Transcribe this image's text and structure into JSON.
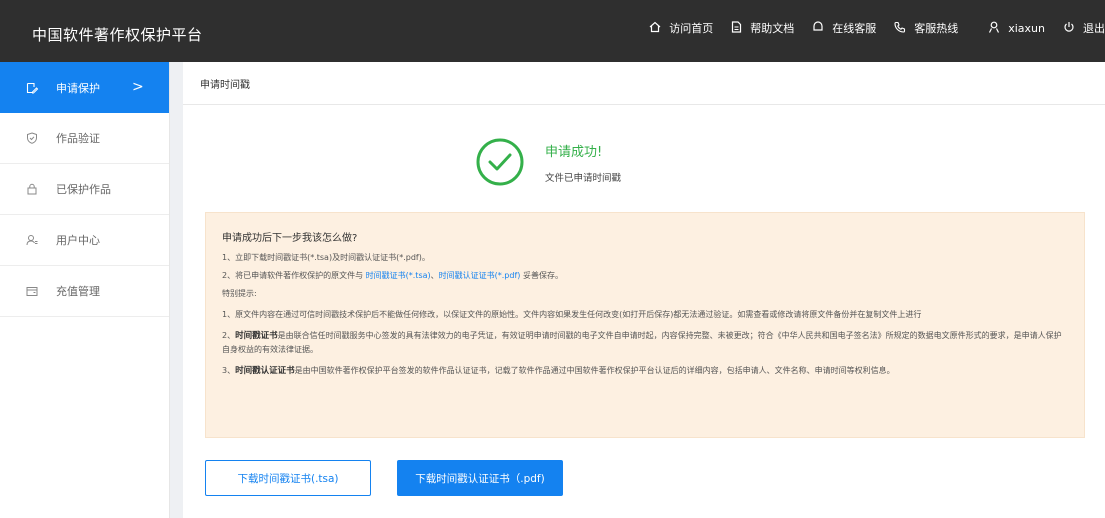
{
  "header": {
    "app_title": "中国软件著作权保护平台",
    "nav": [
      {
        "label": "访问首页",
        "icon": "home-icon"
      },
      {
        "label": "帮助文档",
        "icon": "document-icon"
      },
      {
        "label": "在线客服",
        "icon": "chat-icon"
      },
      {
        "label": "客服热线",
        "icon": "phone-icon"
      },
      {
        "label": "xiaxun",
        "icon": "user-icon"
      },
      {
        "label": "退出",
        "icon": "power-icon"
      }
    ]
  },
  "sidebar": {
    "items": [
      {
        "label": "申请保护",
        "icon": "edit-icon",
        "active": true
      },
      {
        "label": "作品验证",
        "icon": "shield-icon"
      },
      {
        "label": "已保护作品",
        "icon": "lock-icon"
      },
      {
        "label": "用户中心",
        "icon": "user-icon"
      },
      {
        "label": "充值管理",
        "icon": "wallet-icon"
      }
    ],
    "active_chevron": ">"
  },
  "main": {
    "breadcrumb": "申请时间戳",
    "success": {
      "title": "申请成功!",
      "subtitle": "文件已申请时间戳"
    },
    "notice": {
      "heading": "申请成功后下一步我该怎么做?",
      "step1": "1、立即下载时间戳证书(*.tsa)及时间戳认证证书(*.pdf)。",
      "step2_prefix": "2、将已申请软件著作权保护的原文件与",
      "step2_link1": "时间戳证书(*.tsa)",
      "step2_sep": "、",
      "step2_link2": "时间戳认证证书(*.pdf)",
      "step2_suffix": "妥善保存。",
      "tips_heading": "特别提示:",
      "tip1": "1、原文件内容在通过可信时间戳技术保护后不能做任何修改，以保证文件的原始性。文件内容如果发生任何改变(如打开后保存)都无法通过验证。如需查看或修改请将原文件备份并在复制文件上进行",
      "tip2_prefix": "2、",
      "tip2_bold": "时间戳证书",
      "tip2_text": "是由联合信任时间戳服务中心签发的具有法律效力的电子凭证，有效证明申请时间戳的电子文件自申请时起，内容保持完整、未被更改；符合《中华人民共和国电子签名法》所规定的数据电文原件形式的要求，是申请人保护自身权益的有效法律证据。",
      "tip3_prefix": "3、",
      "tip3_bold": "时间戳认证证书",
      "tip3_text": "是由中国软件著作权保护平台签发的软件作品认证证书，记载了软件作品通过中国软件著作权保护平台认证后的详细内容，包括申请人、文件名称、申请时间等权利信息。"
    },
    "buttons": {
      "download_tsa": "下载时间戳证书(.tsa)",
      "download_pdf": "下载时间戳认证证书（.pdf)"
    }
  },
  "colors": {
    "accent": "#1482f0",
    "success": "#34b04a",
    "header_bg": "#2f2f2f",
    "notice_bg": "#fdf0e1"
  }
}
